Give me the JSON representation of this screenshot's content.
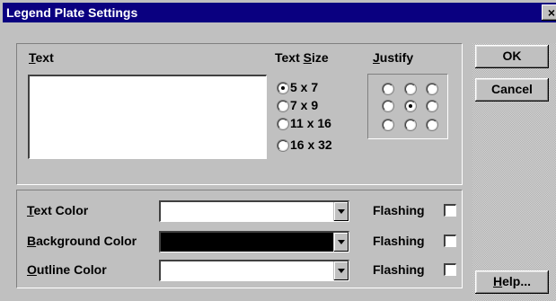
{
  "window": {
    "title": "Legend Plate Settings",
    "close_glyph": "×"
  },
  "text_section": {
    "label": "Text",
    "value": ""
  },
  "text_size": {
    "label": "Text Size",
    "options": [
      "5 x 7",
      "7 x 9",
      "11 x 16",
      "16 x 32"
    ],
    "selected": "5 x 7"
  },
  "justify": {
    "label": "Justify",
    "selected_row": 2,
    "selected_col": 2
  },
  "colors": {
    "text_color": {
      "label": "Text Color",
      "swatch": "#ffffff",
      "flashing_label": "Flashing"
    },
    "background_color": {
      "label": "Background Color",
      "swatch": "#000000",
      "flashing_label": "Flashing"
    },
    "outline_color": {
      "label": "Outline Color",
      "swatch": "#ffffff",
      "flashing_label": "Flashing"
    }
  },
  "buttons": {
    "ok": "OK",
    "cancel": "Cancel",
    "help": "Help..."
  }
}
